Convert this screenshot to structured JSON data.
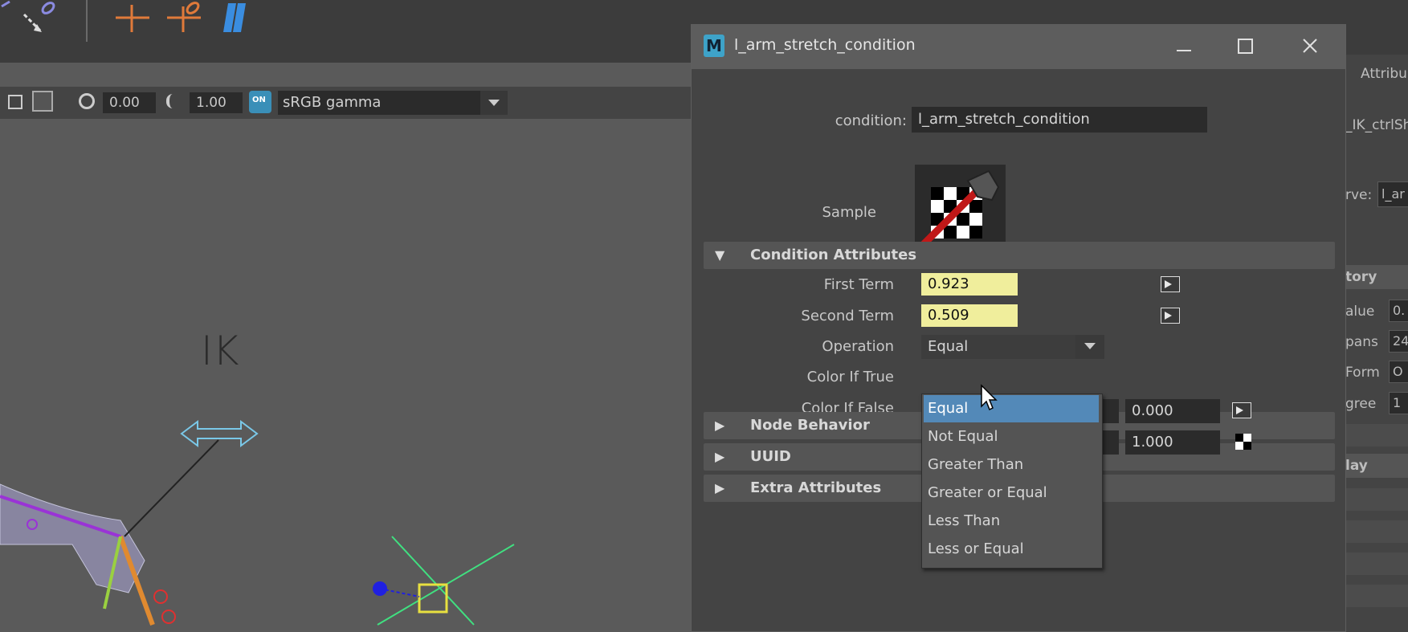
{
  "toolbar": {
    "icons": [
      "joint-connect-icon",
      "ik-handle-icon",
      "ik-spline-icon",
      "smooth-icon"
    ]
  },
  "viewport_bar": {
    "exposure_value": "0.00",
    "gamma_value": "1.00",
    "color_space": "sRGB gamma",
    "toggle_label": "ON"
  },
  "viewport": {
    "ik_label": "IK"
  },
  "dialog": {
    "title": "l_arm_stretch_condition",
    "condition_label": "condition:",
    "condition_value": "l_arm_stretch_condition",
    "sample_label": "Sample",
    "sections": {
      "condition_attributes": "Condition Attributes",
      "node_behavior": "Node Behavior",
      "uuid": "UUID",
      "extra_attributes": "Extra Attributes"
    },
    "first_term_label": "First Term",
    "first_term_value": "0.923",
    "second_term_label": "Second Term",
    "second_term_value": "0.509",
    "operation_label": "Operation",
    "operation_value": "Equal",
    "color_if_true_label": "Color If True",
    "color_if_true_b": "0.000",
    "color_if_false_label": "Color If False",
    "color_if_false_b": "1.000"
  },
  "operation_menu": {
    "items": [
      "Equal",
      "Not Equal",
      "Greater Than",
      "Greater or Equal",
      "Less Than",
      "Less or Equal"
    ],
    "selected": "Equal"
  },
  "right_panel": {
    "tab": "Attribu",
    "node_field": "_IK_ctrlSh",
    "curve_label": "rve:",
    "curve_value": "l_ar",
    "history_label": "tory",
    "rows": [
      {
        "label": "alue",
        "value": "0."
      },
      {
        "label": "pans",
        "value": "24"
      },
      {
        "label": "Form",
        "value": "O"
      },
      {
        "label": "gree",
        "value": "1"
      }
    ],
    "display_label": "lay"
  },
  "colors": {
    "accent_selection": "#5389b8",
    "term_highlight": "#f0ee9c",
    "maya_icon": "#3ea3c9"
  }
}
